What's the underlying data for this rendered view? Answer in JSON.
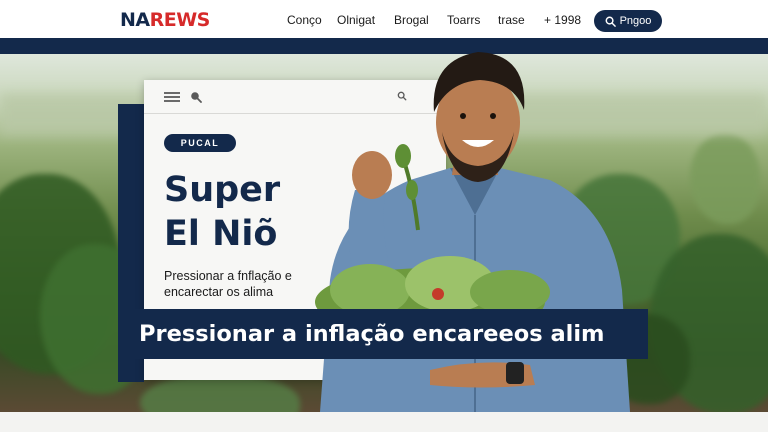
{
  "brand": {
    "logo_main": "NA",
    "logo_accent": "REWS"
  },
  "nav": {
    "items": [
      "Conço",
      "Olnigat",
      "Brogal",
      "Toarrs",
      "trase",
      "+ 1998"
    ],
    "button_label": "Pngoo"
  },
  "card": {
    "badge": "PUCAL",
    "title_line1": "Super",
    "title_line2": "El Niõ",
    "subtitle": "Pressionar a fnflação e encarectar os alima"
  },
  "headline": "Pressionar a inflação encareeos alim",
  "colors": {
    "navy": "#13294b",
    "logo_red": "#d62a2a",
    "card_bg": "#f7f7f5"
  },
  "icons": [
    "menu-icon",
    "search-icon",
    "search-icon"
  ]
}
